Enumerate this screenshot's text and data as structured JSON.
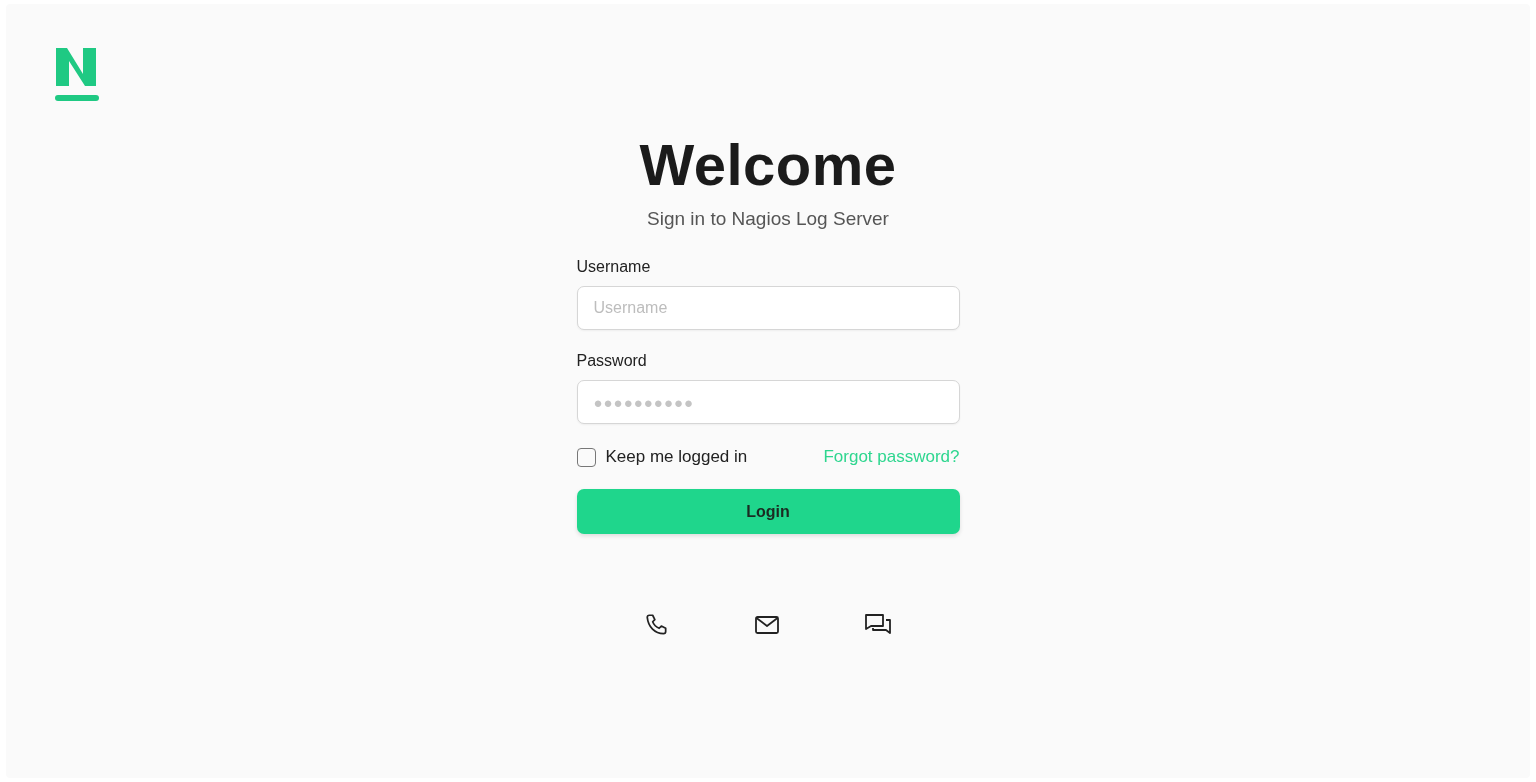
{
  "heading": "Welcome",
  "subtitle": "Sign in to Nagios Log Server",
  "username": {
    "label": "Username",
    "placeholder": "Username"
  },
  "password": {
    "label": "Password",
    "value": "●●●●●●●●●●"
  },
  "remember": {
    "label": "Keep me logged in",
    "checked": false
  },
  "forgot_link": "Forgot password?",
  "login_button": "Login",
  "contact_icons": [
    {
      "kind": "phone"
    },
    {
      "kind": "mail"
    },
    {
      "kind": "chat"
    }
  ]
}
